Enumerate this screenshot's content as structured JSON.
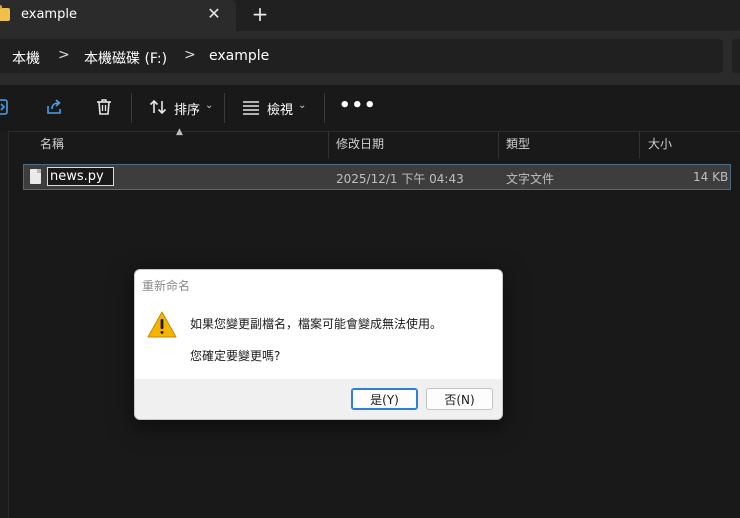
{
  "tab": {
    "title": "example",
    "close_glyph": "✕",
    "new_tab_glyph": "+"
  },
  "breadcrumb": {
    "items": [
      "本機",
      "本機磁碟 (F:)",
      "example"
    ],
    "separator": ">"
  },
  "toolbar": {
    "sort_label": "排序",
    "view_label": "檢視",
    "more_glyph": "•••",
    "chevron_glyph": "⌄"
  },
  "file_list": {
    "columns": [
      "名稱",
      "修改日期",
      "類型",
      "大小"
    ],
    "rows": [
      {
        "name": "news.py",
        "modified": "2025/12/1 下午 04:43",
        "type": "文字文件",
        "size": "14 KB"
      }
    ]
  },
  "dialog": {
    "title": "重新命名",
    "message_line1": "如果您變更副檔名，檔案可能會變成無法使用。",
    "message_line2": "您確定要變更嗎?",
    "yes_label": "是(Y)",
    "no_label": "否(N)"
  },
  "colors": {
    "accent": "#2f7fd6",
    "warning": "#f4b400",
    "folder": "#f1c04a"
  }
}
